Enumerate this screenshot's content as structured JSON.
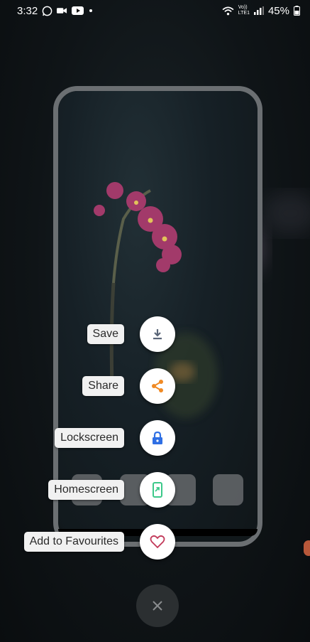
{
  "status_bar": {
    "time": "3:32",
    "network": "LTE1",
    "volte": "Vo))",
    "battery": "45%"
  },
  "actions": [
    {
      "label": "Save",
      "icon": "download-icon",
      "color": "#5a6678"
    },
    {
      "label": "Share",
      "icon": "share-icon",
      "color": "#f08a24"
    },
    {
      "label": "Lockscreen",
      "icon": "lock-icon",
      "color": "#2f6fe4"
    },
    {
      "label": "Homescreen",
      "icon": "homescreen-icon",
      "color": "#3cc98a"
    },
    {
      "label": "Add to Favourites",
      "icon": "heart-icon",
      "color": "#c23a5a"
    }
  ],
  "close_button": {
    "icon": "close-icon"
  }
}
